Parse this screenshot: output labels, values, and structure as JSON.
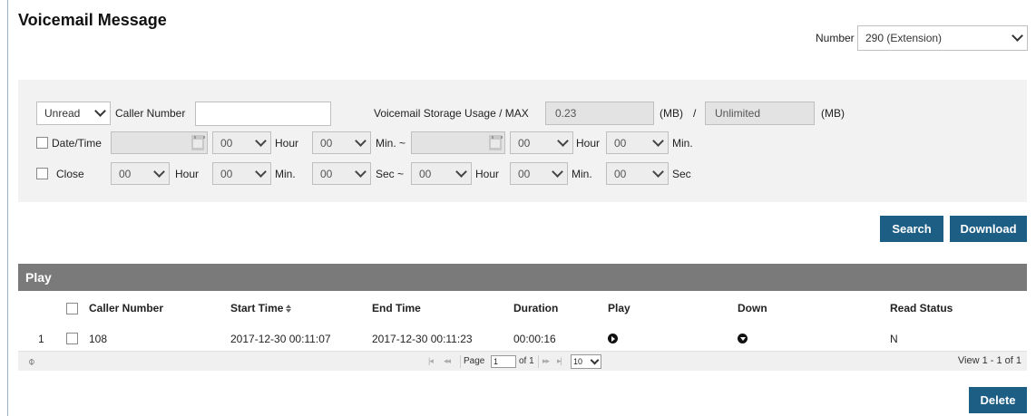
{
  "page_title": "Voicemail Message",
  "number_filter": {
    "label": "Number",
    "value": "290 (Extension)"
  },
  "filters": {
    "read_state": "Unread",
    "caller_number_label": "Caller Number",
    "caller_number_value": "",
    "storage_label": "Voicemail Storage Usage / MAX",
    "storage_used": "0.23",
    "storage_unit_1": "(MB)",
    "storage_slash": "/",
    "storage_max": "Unlimited",
    "storage_unit_2": "(MB)",
    "datetime_label": "Date/Time",
    "close_label": "Close",
    "zero": "00",
    "hour_label": "Hour",
    "min_label": "Min.",
    "min_range_label": "Min. ~",
    "sec_range_label": "Sec ~",
    "sec_label": "Sec"
  },
  "buttons": {
    "search": "Search",
    "download": "Download",
    "delete": "Delete"
  },
  "grid": {
    "title": "Play",
    "columns": {
      "caller_number": "Caller Number",
      "start_time": "Start Time",
      "end_time": "End Time",
      "duration": "Duration",
      "play": "Play",
      "down": "Down",
      "read_status": "Read Status"
    },
    "rows": [
      {
        "index": "1",
        "caller_number": "108",
        "start_time": "2017-12-30 00:11:07",
        "end_time": "2017-12-30 00:11:23",
        "duration": "00:00:16",
        "read_status": "N"
      }
    ]
  },
  "pager": {
    "page_label": "Page",
    "page_value": "1",
    "of_label": "of 1",
    "rows_per_page": "10",
    "view_info": "View 1 - 1 of 1",
    "refresh_glyph": "⌽",
    "first_glyph": "|◂",
    "prev_glyph": "◂◂",
    "next_glyph": "▸▸",
    "last_glyph": "▸|"
  },
  "colors": {
    "accent": "#1d5e85",
    "grid_header": "#7a7a7a",
    "panel": "#f2f2f2"
  }
}
